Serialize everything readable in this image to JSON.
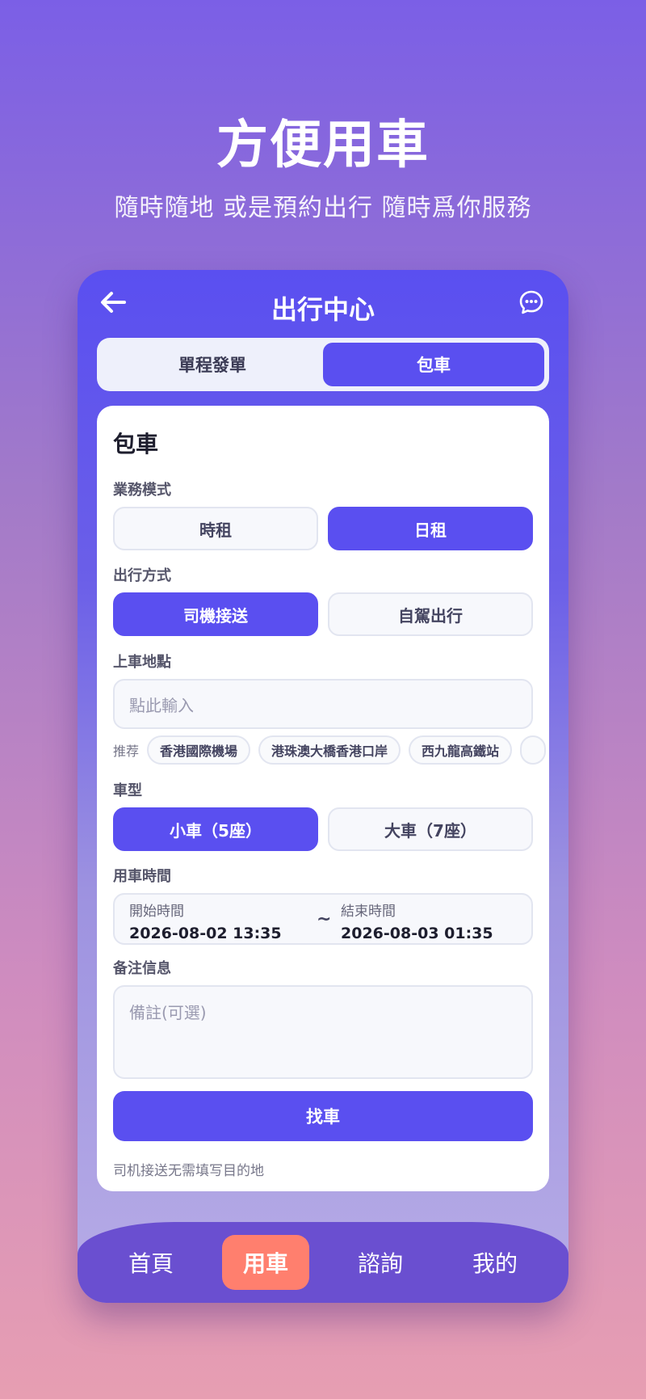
{
  "hero": {
    "title": "方便用車",
    "subtitle": "隨時隨地 或是預約出行 隨時爲你服務"
  },
  "topbar": {
    "title": "出行中心",
    "back_icon": "arrow-left-icon",
    "chat_icon": "chat-bubble-icon"
  },
  "segment": {
    "tabs": [
      {
        "label": "單程發單",
        "active": false
      },
      {
        "label": "包車",
        "active": true
      }
    ]
  },
  "form": {
    "title": "包車",
    "business_mode": {
      "label": "業務模式",
      "options": [
        {
          "label": "時租",
          "active": false
        },
        {
          "label": "日租",
          "active": true
        }
      ]
    },
    "travel_mode": {
      "label": "出行方式",
      "options": [
        {
          "label": "司機接送",
          "active": true
        },
        {
          "label": "自駕出行",
          "active": false
        }
      ]
    },
    "pickup": {
      "label": "上車地點",
      "placeholder": "點此輸入",
      "recommend_label": "推荐",
      "suggestions": [
        "香港國際機場",
        "港珠澳大橋香港口岸",
        "西九龍高鐵站"
      ]
    },
    "vehicle": {
      "label": "車型",
      "options": [
        {
          "label": "小車（5座）",
          "active": true
        },
        {
          "label": "大車（7座）",
          "active": false
        }
      ]
    },
    "time": {
      "label": "用車時間",
      "start_caption": "開始時間",
      "start_value": "2026-08-02 13:35",
      "separator": "~",
      "end_caption": "結束時間",
      "end_value": "2026-08-03 01:35"
    },
    "notes": {
      "label": "备注信息",
      "placeholder": "備註(可選)"
    },
    "submit_label": "找車",
    "hint": "司机接送无需填写目的地"
  },
  "tabbar": {
    "items": [
      {
        "label": "首頁",
        "active": false
      },
      {
        "label": "用車",
        "active": true
      },
      {
        "label": "諮詢",
        "active": false
      },
      {
        "label": "我的",
        "active": false
      }
    ]
  },
  "colors": {
    "accent": "#5a4ff0",
    "tab_active": "#ff7f6e"
  }
}
